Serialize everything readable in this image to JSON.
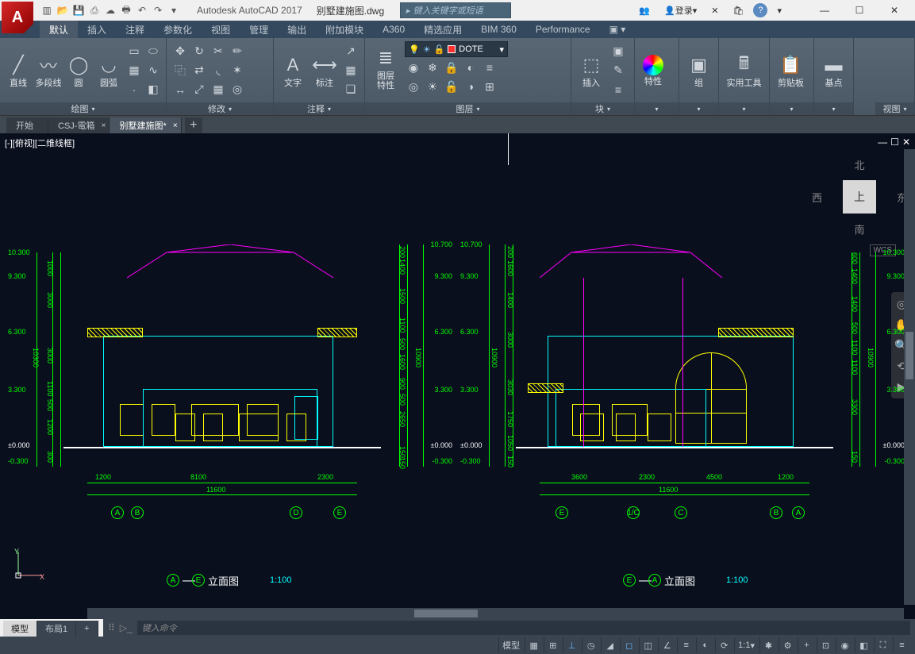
{
  "app": {
    "name": "Autodesk AutoCAD 2017",
    "filename": "别墅建施图.dwg"
  },
  "search": {
    "placeholder": "键入关键字或短语"
  },
  "login": {
    "label": "登录"
  },
  "window": {
    "min": "—",
    "max": "☐",
    "close": "✕"
  },
  "ribbon_tabs": [
    "默认",
    "插入",
    "注释",
    "参数化",
    "视图",
    "管理",
    "输出",
    "附加模块",
    "A360",
    "精选应用",
    "BIM 360",
    "Performance"
  ],
  "ribbon_panels": {
    "draw": {
      "title": "绘图",
      "btns": [
        "直线",
        "多段线",
        "圆",
        "圆弧"
      ]
    },
    "modify": {
      "title": "修改"
    },
    "annot": {
      "title": "注释",
      "btns": [
        "文字",
        "标注"
      ]
    },
    "layers": {
      "title": "图层",
      "big": "图层\n特性",
      "current": "DOTE"
    },
    "block": {
      "title": "块",
      "big": "插入"
    },
    "props": {
      "title": "特性"
    },
    "group": {
      "title": "组"
    },
    "util": {
      "title": "实用工具"
    },
    "clip": {
      "title": "剪贴板"
    },
    "base": {
      "title": "基点"
    },
    "view": {
      "title": "视图"
    }
  },
  "file_tabs": [
    "开始",
    "CSJ-電箱",
    "别墅建施图*"
  ],
  "viewport_label": "[-][俯视][二维线框]",
  "viewcube": {
    "top": "上",
    "n": "北",
    "s": "南",
    "e": "东",
    "w": "西",
    "wcs": "WCS"
  },
  "drawing": {
    "left": {
      "title": "立面图",
      "scale": "1:100",
      "axes": [
        "A",
        "B",
        "D",
        "E"
      ],
      "h_dims": [
        "1200",
        "8100",
        "2300",
        "11600"
      ],
      "v_left_levels": [
        "10.300",
        "9.300",
        "6.300",
        "3.300",
        "±0.000",
        "-0.300"
      ],
      "v_left_dims": [
        "1000",
        "3000",
        "3000",
        "1100",
        "500",
        "1200",
        "300",
        "10300"
      ],
      "v_right_levels": [
        "10.700",
        "9.300",
        "6.300",
        "3.300",
        "±0.000",
        "-0.300"
      ],
      "v_right_dims": [
        "200",
        "1400",
        "1500",
        "1100",
        "500",
        "1600",
        "900",
        "500",
        "2650",
        "150",
        "150",
        "10900"
      ]
    },
    "right": {
      "title": "立面图",
      "scale": "1:100",
      "axes": [
        "E",
        "1/C",
        "C",
        "B",
        "A"
      ],
      "h_dims": [
        "3600",
        "2300",
        "4500",
        "1200",
        "11600"
      ],
      "v_left_levels": [
        "10.700",
        "9.300",
        "6.300",
        "3.300",
        "±0.000",
        "-0.300"
      ],
      "v_left_dims": [
        "200",
        "1600",
        "1400",
        "3000",
        "3030",
        "1750",
        "1050",
        "150",
        "10900"
      ],
      "v_right_levels": [
        "10.300",
        "9.300",
        "6.300",
        "3.300",
        "±0.000",
        "-0.300"
      ],
      "v_right_dims": [
        "600",
        "1400",
        "1400",
        "500",
        "1100",
        "1100",
        "3300",
        "150",
        "10900"
      ]
    }
  },
  "cmdline": {
    "placeholder": "键入命令"
  },
  "layout_tabs": [
    "模型",
    "布局1"
  ],
  "status": {
    "model": "模型",
    "scale": "1:1"
  }
}
